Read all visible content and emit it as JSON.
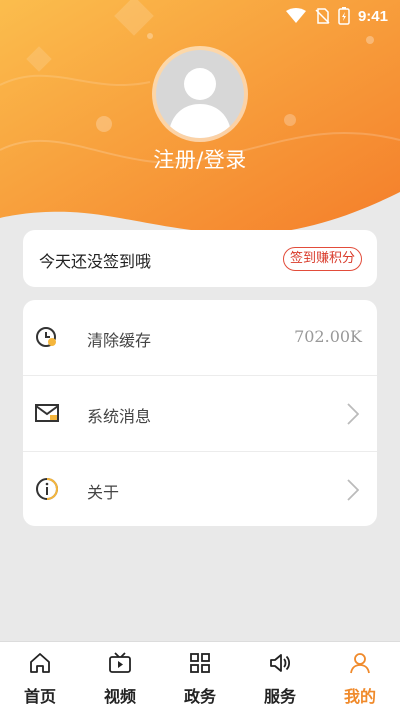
{
  "status_bar": {
    "time": "9:41"
  },
  "profile": {
    "login_label": "注册/登录"
  },
  "signin": {
    "text": "今天还没签到哦",
    "button_label": "签到赚积分"
  },
  "menu": {
    "items": [
      {
        "icon": "clock-clean-icon",
        "label": "清除缓存",
        "value": "702.00K"
      },
      {
        "icon": "envelope-icon",
        "label": "系统消息"
      },
      {
        "icon": "info-icon",
        "label": "关于"
      }
    ]
  },
  "tabbar": {
    "items": [
      {
        "icon": "home-icon",
        "label": "首页"
      },
      {
        "icon": "video-icon",
        "label": "视频"
      },
      {
        "icon": "grid-icon",
        "label": "政务"
      },
      {
        "icon": "speaker-icon",
        "label": "服务"
      },
      {
        "icon": "person-icon",
        "label": "我的",
        "active": true
      }
    ]
  },
  "colors": {
    "accent": "#f08a2b",
    "header_top": "#fbb94a",
    "header_bottom": "#f5842c",
    "badge_red": "#d93a2a"
  }
}
